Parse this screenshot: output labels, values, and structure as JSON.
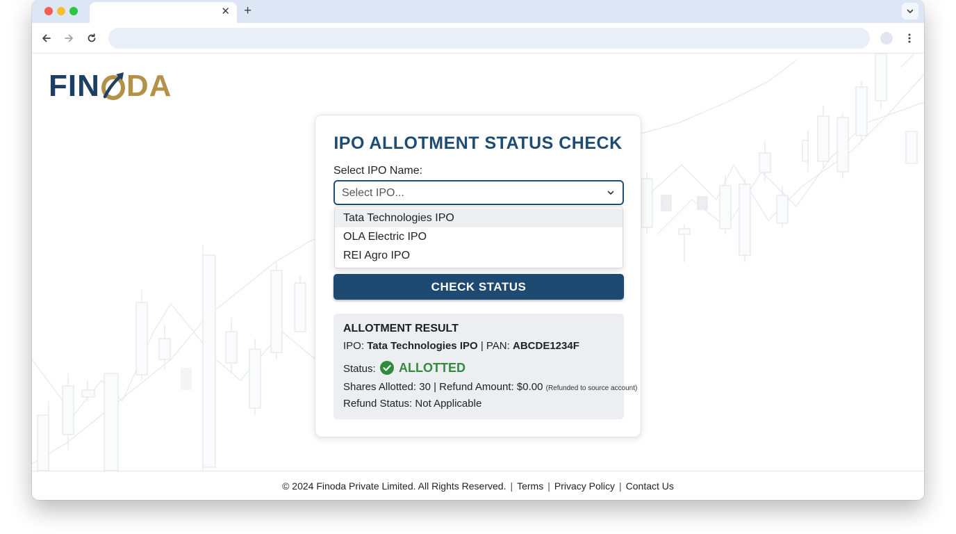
{
  "browser": {
    "tab_close_icon": "close-icon",
    "new_tab_icon": "plus-icon",
    "tabs_menu_icon": "chevron-down-icon",
    "back_icon": "arrow-left-icon",
    "forward_icon": "arrow-right-icon",
    "reload_icon": "reload-icon",
    "menu_icon": "more-vertical-icon"
  },
  "logo": {
    "part1": "FIN",
    "part2": "DA"
  },
  "form": {
    "title": "IPO ALLOTMENT STATUS CHECK",
    "select_label": "Select IPO Name:",
    "select_placeholder": "Select IPO...",
    "options": [
      "Tata Technologies IPO",
      "OLA Electric IPO",
      "REI Agro IPO"
    ],
    "highlighted_option": "Tata Technologies IPO",
    "check_button": "CHECK STATUS"
  },
  "result": {
    "title": "ALLOTMENT RESULT",
    "ipo_label": "IPO:",
    "ipo_value": "Tata Technologies IPO",
    "pan_label": "| PAN:",
    "pan_value": "ABCDE1234F",
    "status_label": "Status:",
    "status_value": "ALLOTTED",
    "status_color": "#2f8c3c",
    "shares_text": "Shares Allotted: 30 | Refund Amount: $0.00",
    "refund_note": "(Refunded to source account)",
    "refund_status": "Refund Status: Not Applicable"
  },
  "footer": {
    "copyright": "© 2024 Finoda Private Limited. All Rights Reserved.",
    "separator": "|",
    "links": [
      "Terms",
      "Privacy Policy",
      "Contact Us"
    ]
  },
  "colors": {
    "brand_navy": "#1c3f63",
    "brand_gold": "#b39148",
    "button": "#1e4a72"
  }
}
